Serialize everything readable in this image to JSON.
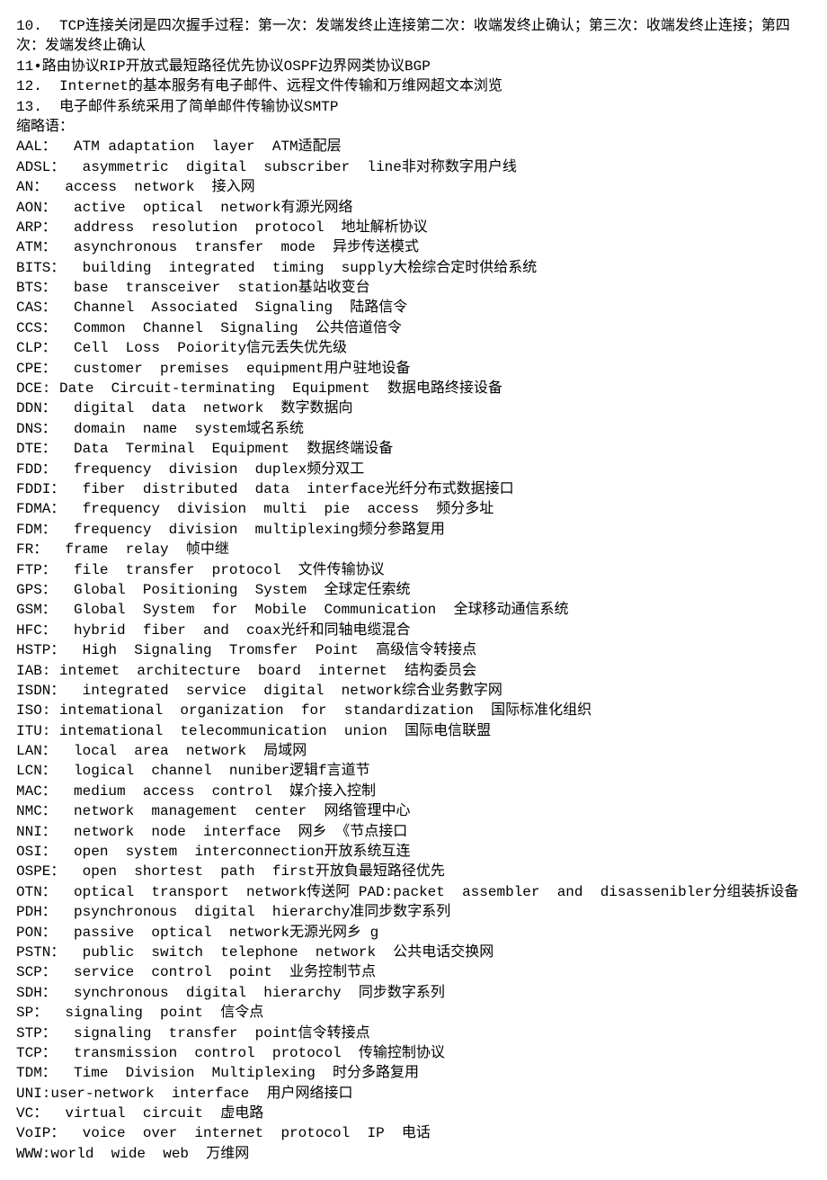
{
  "lines": [
    "10.  TCP连接关闭是四次握手过程：第一次：发端发终止连接第二次：收端发终止确认；第三次：收端发终止连接；第四 次：发端发终止确认",
    "11•路由协议RIP开放式最短路径优先协议OSPF边界网类协议BGP",
    "12.  Internet的基本服务有电子邮件、远程文件传输和万维网超文本浏览",
    "13.  电子邮件系统采用了简单邮件传输协议SMTP",
    "缩略语：",
    "AAL：  ATM adaptation  layer  ATM适配层",
    "ADSL：  asymmetric  digital  subscriber  line非对称数字用户线",
    "AN：  access  network  接入网",
    "AON：  active  optical  network有源光网络",
    "ARP：  address  resolution  protocol  地址解析协议",
    "ATM：  asynchronous  transfer  mode  异步传送模式",
    "BITS：  building  integrated  timing  supply大桧综合定时供给系统",
    "BTS：  base  transceiver  station基站收变台",
    "CAS：  Channel  Associated  Signaling  陆路信令",
    "CCS：  Common  Channel  Signaling  公共倍道倍令",
    "CLP：  Cell  Loss  Poiority信元丢失优先级",
    "CPE：  customer  premises  equipment用户驻地设备",
    "DCE: Date  Circuit-terminating  Equipment  数据电路终接设备",
    "DDN：  digital  data  network  数字数据向",
    "DNS：  domain  name  system域名系统",
    "DTE：  Data  Terminal  Equipment  数据终端设备",
    "FDD：  frequency  division  duplex频分双工",
    "FDDI：  fiber  distributed  data  interface光纤分布式数据接口",
    "FDMA：  frequency  division  multi  pie  access  频分多址",
    "FDM：  frequency  division  multiplexing频分参路复用",
    "FR：  frame  relay  帧中继",
    "FTP：  file  transfer  protocol  文件传输协议",
    "GPS：  Global  Positioning  System  全球定任索统",
    "GSM：  Global  System  for  Mobile  Communication  全球移动通信系统",
    "HFC：  hybrid  fiber  and  coax光纤和同轴电缆混合",
    "HSTP：  High  Signaling  Tromsfer  Point  高级信令转接点",
    "IAB: intemet  architecture  board  internet  结构委员会",
    "ISDN：  integrated  service  digital  network综合业务數字网",
    "ISO: intemational  organization  for  standardization  国际标准化组织",
    "ITU: intemational  telecommunication  union  国际电信联盟",
    "LAN：  local  area  network  局域网",
    "LCN：  logical  channel  nuniber逻辑f言道节",
    "MAC：  medium  access  control  媒介接入控制",
    "NMC：  network  management  center  网络管理中心",
    "NNI：  network  node  interface  网乡 《节点接口",
    "OSI：  open  system  interconnection开放系统互连",
    "OSPE：  open  shortest  path  first开放負最短路径优先",
    "OTN：  optical  transport  network传送阿 PAD:packet  assembler  and  disassenibler分组装拆设备",
    "PDH：  psynchronous  digital  hierarchy准同步数字系列",
    "PON：  passive  optical  network无源光网乡 g",
    "PSTN：  public  switch  telephone  network  公共电话交换网",
    "SCP：  service  control  point  业务控制节点",
    "SDH：  synchronous  digital  hierarchy  同步数字系列",
    "SP：  signaling  point  信令点",
    "STP：  signaling  transfer  point信令转接点",
    "TCP：  transmission  control  protocol  传输控制协议",
    "TDM：  Time  Division  Multiplexing  时分多路复用",
    "UNI:user-network  interface  用户网络接口",
    "VC：  virtual  circuit  虚电路",
    "VoIP：  voice  over  internet  protocol  IP  电话",
    "WWW:world  wide  web  万维网"
  ]
}
